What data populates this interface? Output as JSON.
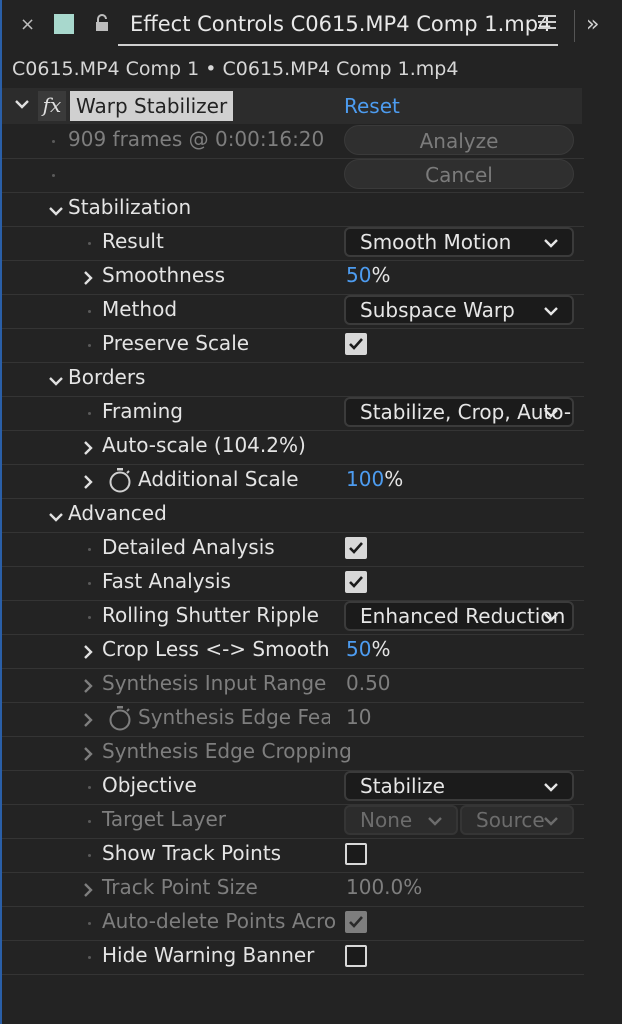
{
  "tab": {
    "title": "Effect Controls C0615.MP4 Comp 1.mp4",
    "close_glyph": "×",
    "more_glyph": "»",
    "swatch_color": "#a8d8cd"
  },
  "breadcrumb": "C0615.MP4 Comp 1 • C0615.MP4 Comp 1.mp4",
  "effect": {
    "fx_label": "fx",
    "name": "Warp Stabilizer",
    "reset_label": "Reset",
    "analysis_status": "909 frames @ 0:00:16:20",
    "analyze_label": "Analyze",
    "cancel_label": "Cancel"
  },
  "sections": {
    "stabilization": "Stabilization",
    "borders": "Borders",
    "advanced": "Advanced"
  },
  "stabilization": {
    "result_label": "Result",
    "result_value": "Smooth Motion",
    "smoothness_label": "Smoothness",
    "smoothness_value": "50",
    "smoothness_unit": "%",
    "method_label": "Method",
    "method_value": "Subspace Warp",
    "preserve_scale_label": "Preserve Scale",
    "preserve_scale_checked": true
  },
  "borders": {
    "framing_label": "Framing",
    "framing_value": "Stabilize, Crop, Auto-scale",
    "autoscale_label": "Auto-scale (104.2%)",
    "additional_scale_label": "Additional Scale",
    "additional_scale_value": "100",
    "additional_scale_unit": "%"
  },
  "advanced": {
    "detailed_analysis_label": "Detailed Analysis",
    "detailed_analysis_checked": true,
    "fast_analysis_label": "Fast Analysis",
    "fast_analysis_checked": true,
    "rolling_shutter_label": "Rolling Shutter Ripple",
    "rolling_shutter_value": "Enhanced Reduction",
    "crop_less_label": "Crop Less <-> Smooth",
    "crop_less_value": "50",
    "crop_less_unit": "%",
    "synth_input_label": "Synthesis Input Range (",
    "synth_input_value": "0.50",
    "synth_edge_feather_label": "Synthesis Edge Feat",
    "synth_edge_feather_value": "10",
    "synth_edge_crop_label": "Synthesis Edge Cropping",
    "objective_label": "Objective",
    "objective_value": "Stabilize",
    "target_layer_label": "Target Layer",
    "target_layer_value": "None",
    "target_source_value": "Source",
    "show_track_points_label": "Show Track Points",
    "show_track_points_checked": false,
    "track_point_size_label": "Track Point Size",
    "track_point_size_value": "100.0%",
    "auto_delete_label": "Auto-delete Points Acro",
    "auto_delete_checked": true,
    "hide_warning_label": "Hide Warning Banner",
    "hide_warning_checked": false
  }
}
